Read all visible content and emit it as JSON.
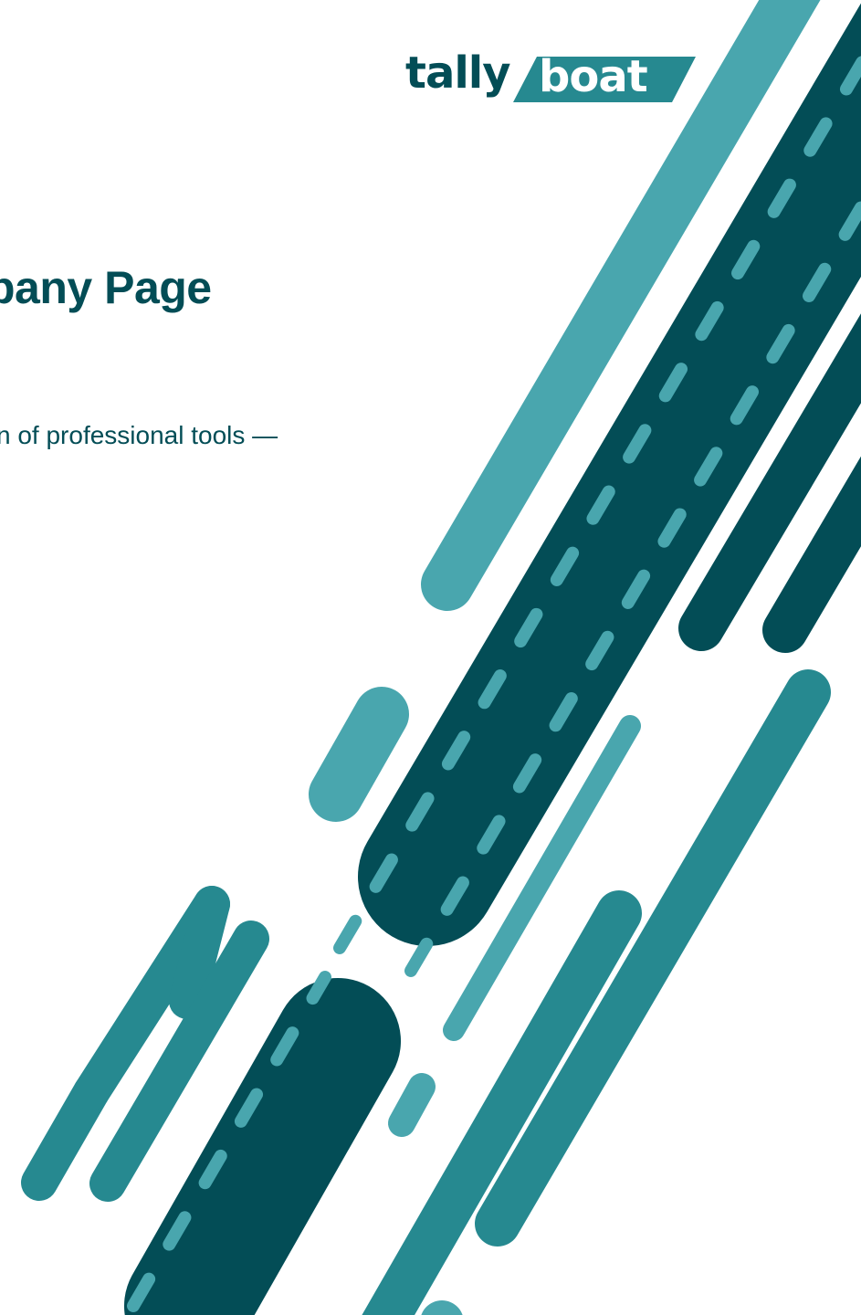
{
  "document": {
    "title_fragment": "pany Page",
    "subtitle_fragment": "n of professional tools —"
  },
  "logo": {
    "word_part1": "tally",
    "word_part2": "boat"
  },
  "colors": {
    "dark_teal": "#034d56",
    "teal": "#268990",
    "light_teal": "#49a6ae"
  },
  "icons": [
    "tallyboat-logo",
    "diagonal-stripe-decoration"
  ]
}
